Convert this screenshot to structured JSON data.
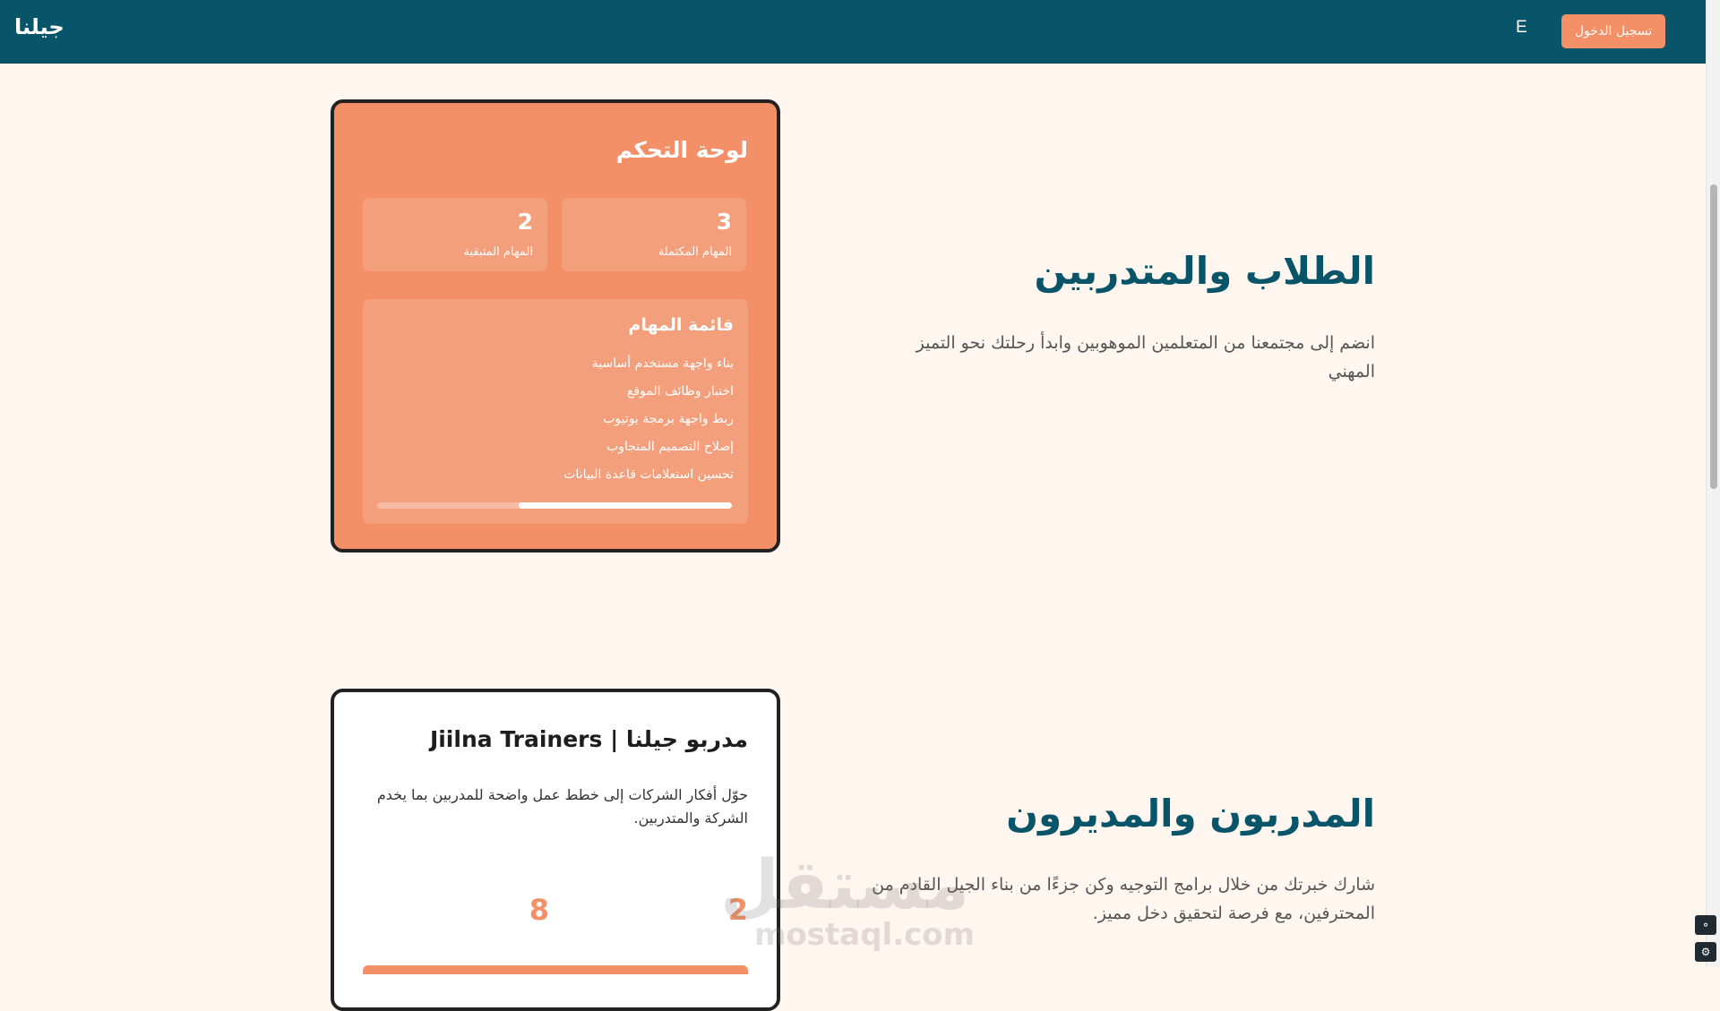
{
  "header": {
    "brand": "جيلنا",
    "language_toggle": "E",
    "login_label": "تسجيل الدخول"
  },
  "dashboard": {
    "title": "لوحة التحكم",
    "stats": [
      {
        "value": "3",
        "label": "المهام المكتملة"
      },
      {
        "value": "2",
        "label": "المهام المتبقية"
      }
    ],
    "tasks_title": "قائمة المهام",
    "tasks": [
      "بناء واجهة مستخدم أساسية",
      "اختبار وظائف الموقع",
      "ربط واجهة برمجة يوتيوب",
      "إصلاح التصميم المتجاوب",
      "تحسين استعلامات قاعدة البيانات"
    ],
    "progress_percent": 60
  },
  "students_section": {
    "heading": "الطلاب والمتدربين",
    "description": "انضم إلى مجتمعنا من المتعلمين الموهوبين وابدأ رحلتك نحو التميز المهني"
  },
  "trainers_card": {
    "title": "مدربو جيلنا | Jiilna Trainers",
    "description": "حوّل أفكار الشركات إلى خطط عمل واضحة للمدربين بما يخدم الشركة والمتدربين.",
    "numbers": [
      "2",
      "8"
    ]
  },
  "trainers_section": {
    "heading": "المدربون والمديرون",
    "description": "شارك خبرتك من خلال برامج التوجيه وكن جزءًا من بناء الجيل القادم من المحترفين، مع فرصة لتحقيق دخل مميز."
  },
  "watermark": {
    "arabic": "مستقل",
    "latin": "mostaql.com"
  },
  "colors": {
    "header_bg": "#085468",
    "accent": "#f39067",
    "heading": "#085468",
    "page_bg": "#fff6ef"
  },
  "icons": {
    "dock_top": "microphone-icon",
    "dock_bottom": "settings-icon"
  }
}
